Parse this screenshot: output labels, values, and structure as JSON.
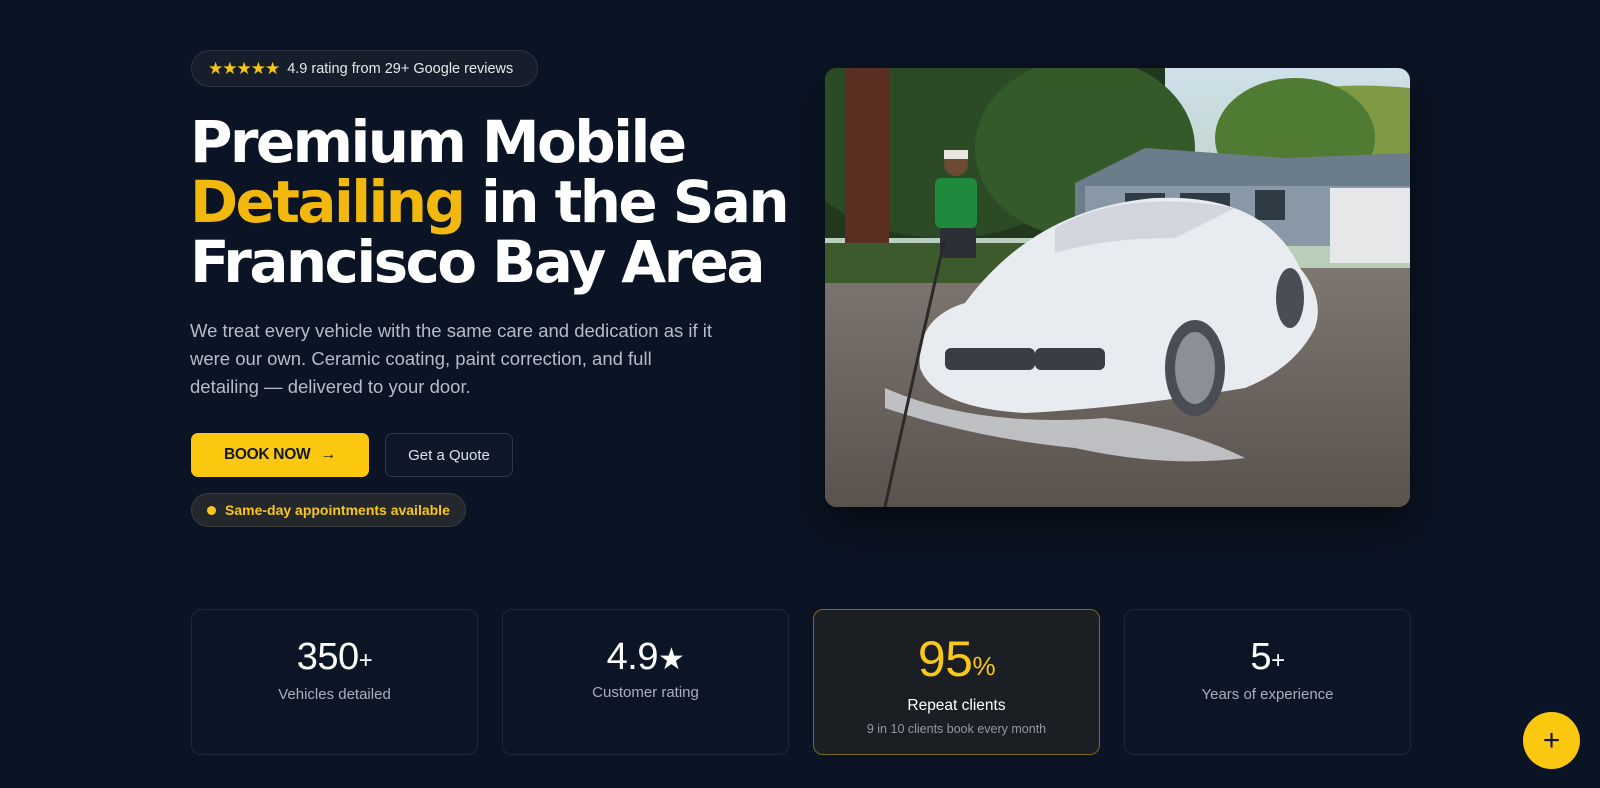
{
  "rating_badge": {
    "stars": "★★★★★",
    "text": "4.9 rating from 29+ Google reviews"
  },
  "hero": {
    "headline_line1": "Premium Mobile",
    "headline_accent": "Detailing",
    "headline_line2_rest": " in the San",
    "headline_line3": "Francisco Bay Area",
    "lead": "We treat every vehicle with the same care and dedication as if it were our own. Ceramic coating, paint correction, and full detailing — delivered to your door.",
    "book_label": "BOOK NOW",
    "book_arrow": "→",
    "quote_label": "Get a Quote",
    "same_day": "Same-day appointments available"
  },
  "stats": [
    {
      "value": "350",
      "suffix": "+",
      "label": "Vehicles detailed"
    },
    {
      "value": "4.9",
      "suffix": "★",
      "label": "Customer rating"
    },
    {
      "value": "95",
      "suffix": "%",
      "label": "Repeat clients",
      "sub": "9 in 10 clients book every month"
    },
    {
      "value": "5",
      "suffix": "+",
      "label": "Years of experience"
    }
  ],
  "fab_label": "+",
  "colors": {
    "background": "#0b1424",
    "accent": "#fcc80f",
    "headline_accent": "#f2b80d"
  },
  "icons": {
    "stars": "star-icon",
    "arrow": "arrow-right-icon",
    "fab": "plus-icon"
  }
}
